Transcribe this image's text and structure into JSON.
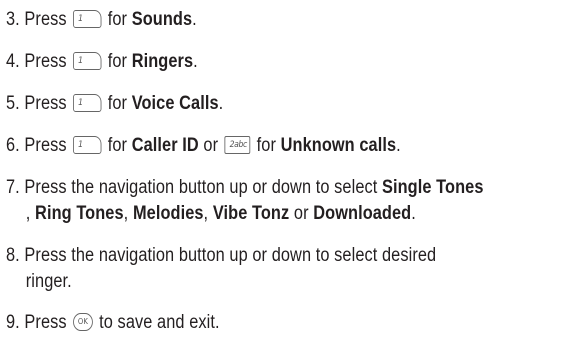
{
  "steps": [
    {
      "num": "3.",
      "press": "Press",
      "key": "1",
      "for": "for",
      "target": "Sounds",
      "end": "."
    },
    {
      "num": "4.",
      "press": "Press",
      "key": "1",
      "for": "for",
      "target": "Ringers",
      "end": "."
    },
    {
      "num": "5.",
      "press": "Press",
      "key": "1",
      "for": "for",
      "target": "Voice Calls",
      "end": "."
    },
    {
      "num": "6.",
      "press": "Press",
      "key": "1",
      "for": "for",
      "target": "Caller ID",
      "or": "or",
      "key2": "2abc",
      "for2": "for",
      "target2": "Unknown calls",
      "end": "."
    },
    {
      "num": "7.",
      "text": "Press the navigation button up or down to select",
      "opt1": "Single Tones",
      "sep1": ",",
      "opt2": "Ring Tones",
      "sep2": ",",
      "opt3": "Melodies",
      "sep3": ",",
      "opt4": "Vibe Tonz",
      "or": "or",
      "opt5": "Downloaded",
      "end": "."
    },
    {
      "num": "8.",
      "line1": "Press the navigation button up or down to select desired",
      "line2": "ringer."
    },
    {
      "num": "9.",
      "press": "Press",
      "key": "OK",
      "rest": "to save and exit."
    }
  ]
}
